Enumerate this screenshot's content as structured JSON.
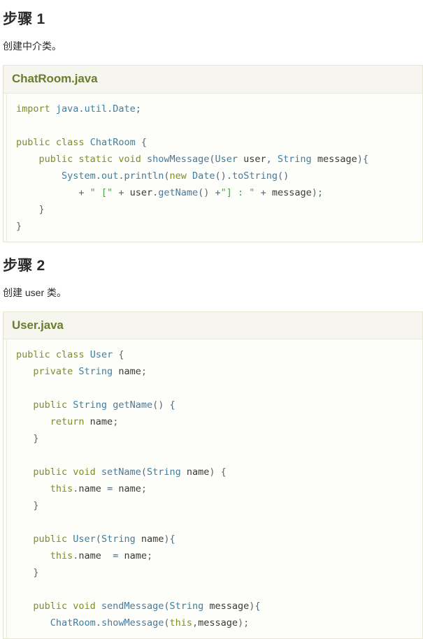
{
  "sections": [
    {
      "heading_label": "步骤",
      "heading_num": "1",
      "description": "创建中介类。",
      "code_title": "ChatRoom.java",
      "code_lines": [
        [
          {
            "t": "import ",
            "c": "kw"
          },
          {
            "t": "java",
            "c": "typ"
          },
          {
            "t": ".",
            "c": "pun"
          },
          {
            "t": "util",
            "c": "typ"
          },
          {
            "t": ".",
            "c": "pun"
          },
          {
            "t": "Date",
            "c": "typ"
          },
          {
            "t": ";",
            "c": "pun"
          }
        ],
        [],
        [
          {
            "t": "public ",
            "c": "kw"
          },
          {
            "t": "class ",
            "c": "kw"
          },
          {
            "t": "ChatRoom",
            "c": "typ"
          },
          {
            "t": " {",
            "c": "pun"
          }
        ],
        [
          {
            "t": "    public ",
            "c": "kw"
          },
          {
            "t": "static ",
            "c": "kw"
          },
          {
            "t": "void ",
            "c": "kw"
          },
          {
            "t": "showMessage",
            "c": "fn"
          },
          {
            "t": "(",
            "c": "pun"
          },
          {
            "t": "User",
            "c": "typ"
          },
          {
            "t": " user",
            "c": "pln"
          },
          {
            "t": ", ",
            "c": "pun"
          },
          {
            "t": "String",
            "c": "typ"
          },
          {
            "t": " message",
            "c": "pln"
          },
          {
            "t": "){",
            "c": "pun"
          }
        ],
        [
          {
            "t": "        System",
            "c": "typ"
          },
          {
            "t": ".",
            "c": "pun"
          },
          {
            "t": "out",
            "c": "typ"
          },
          {
            "t": ".",
            "c": "pun"
          },
          {
            "t": "println",
            "c": "fn"
          },
          {
            "t": "(",
            "c": "pun"
          },
          {
            "t": "new ",
            "c": "kw"
          },
          {
            "t": "Date",
            "c": "typ"
          },
          {
            "t": "()",
            "c": "pun"
          },
          {
            "t": ".",
            "c": "pun"
          },
          {
            "t": "toString",
            "c": "fn"
          },
          {
            "t": "()",
            "c": "pun"
          }
        ],
        [
          {
            "t": "           + ",
            "c": "pun"
          },
          {
            "t": "\" [\"",
            "c": "str"
          },
          {
            "t": " + ",
            "c": "pun"
          },
          {
            "t": "user",
            "c": "pln"
          },
          {
            "t": ".",
            "c": "pun"
          },
          {
            "t": "getName",
            "c": "fn"
          },
          {
            "t": "() +",
            "c": "pun"
          },
          {
            "t": "\"] : \"",
            "c": "str"
          },
          {
            "t": " + ",
            "c": "pun"
          },
          {
            "t": "message",
            "c": "pln"
          },
          {
            "t": ");",
            "c": "pun"
          }
        ],
        [
          {
            "t": "    }",
            "c": "pun"
          }
        ],
        [
          {
            "t": "}",
            "c": "pun"
          }
        ]
      ]
    },
    {
      "heading_label": "步骤",
      "heading_num": "2",
      "description": "创建 user 类。",
      "code_title": "User.java",
      "code_lines": [
        [
          {
            "t": "public ",
            "c": "kw"
          },
          {
            "t": "class ",
            "c": "kw"
          },
          {
            "t": "User",
            "c": "typ"
          },
          {
            "t": " {",
            "c": "pun"
          }
        ],
        [
          {
            "t": "   private ",
            "c": "kw"
          },
          {
            "t": "String",
            "c": "typ"
          },
          {
            "t": " name",
            "c": "pln"
          },
          {
            "t": ";",
            "c": "pun"
          }
        ],
        [],
        [
          {
            "t": "   public ",
            "c": "kw"
          },
          {
            "t": "String",
            "c": "typ"
          },
          {
            "t": " ",
            "c": "pln"
          },
          {
            "t": "getName",
            "c": "fn"
          },
          {
            "t": "() {",
            "c": "pun"
          }
        ],
        [
          {
            "t": "      return ",
            "c": "kw"
          },
          {
            "t": "name",
            "c": "pln"
          },
          {
            "t": ";",
            "c": "pun"
          }
        ],
        [
          {
            "t": "   }",
            "c": "pun"
          }
        ],
        [],
        [
          {
            "t": "   public ",
            "c": "kw"
          },
          {
            "t": "void ",
            "c": "kw"
          },
          {
            "t": "setName",
            "c": "fn"
          },
          {
            "t": "(",
            "c": "pun"
          },
          {
            "t": "String",
            "c": "typ"
          },
          {
            "t": " name",
            "c": "pln"
          },
          {
            "t": ") {",
            "c": "pun"
          }
        ],
        [
          {
            "t": "      this",
            "c": "kw"
          },
          {
            "t": ".",
            "c": "pun"
          },
          {
            "t": "name",
            "c": "pln"
          },
          {
            "t": " = ",
            "c": "pun"
          },
          {
            "t": "name",
            "c": "pln"
          },
          {
            "t": ";",
            "c": "pun"
          }
        ],
        [
          {
            "t": "   }",
            "c": "pun"
          }
        ],
        [],
        [
          {
            "t": "   public ",
            "c": "kw"
          },
          {
            "t": "User",
            "c": "typ"
          },
          {
            "t": "(",
            "c": "pun"
          },
          {
            "t": "String",
            "c": "typ"
          },
          {
            "t": " name",
            "c": "pln"
          },
          {
            "t": "){",
            "c": "pun"
          }
        ],
        [
          {
            "t": "      this",
            "c": "kw"
          },
          {
            "t": ".",
            "c": "pun"
          },
          {
            "t": "name",
            "c": "pln"
          },
          {
            "t": "  = ",
            "c": "pun"
          },
          {
            "t": "name",
            "c": "pln"
          },
          {
            "t": ";",
            "c": "pun"
          }
        ],
        [
          {
            "t": "   }",
            "c": "pun"
          }
        ],
        [],
        [
          {
            "t": "   public ",
            "c": "kw"
          },
          {
            "t": "void ",
            "c": "kw"
          },
          {
            "t": "sendMessage",
            "c": "fn"
          },
          {
            "t": "(",
            "c": "pun"
          },
          {
            "t": "String",
            "c": "typ"
          },
          {
            "t": " message",
            "c": "pln"
          },
          {
            "t": "){",
            "c": "pun"
          }
        ],
        [
          {
            "t": "      ChatRoom",
            "c": "typ"
          },
          {
            "t": ".",
            "c": "pun"
          },
          {
            "t": "showMessage",
            "c": "fn"
          },
          {
            "t": "(",
            "c": "pun"
          },
          {
            "t": "this",
            "c": "kw"
          },
          {
            "t": ",",
            "c": "pun"
          },
          {
            "t": "message",
            "c": "pln"
          },
          {
            "t": ");",
            "c": "pun"
          }
        ]
      ]
    }
  ],
  "colors": {
    "heading": "#2b2b2b",
    "code_title": "#6a7d2e",
    "card_border": "#e6e6d4",
    "card_header_bg": "#f6f6ef",
    "card_body_bg": "#fdfdfa",
    "keyword": "#7f8f1f",
    "type": "#3f7f9f",
    "string": "#4a9f4a",
    "punctuation": "#55687a"
  }
}
